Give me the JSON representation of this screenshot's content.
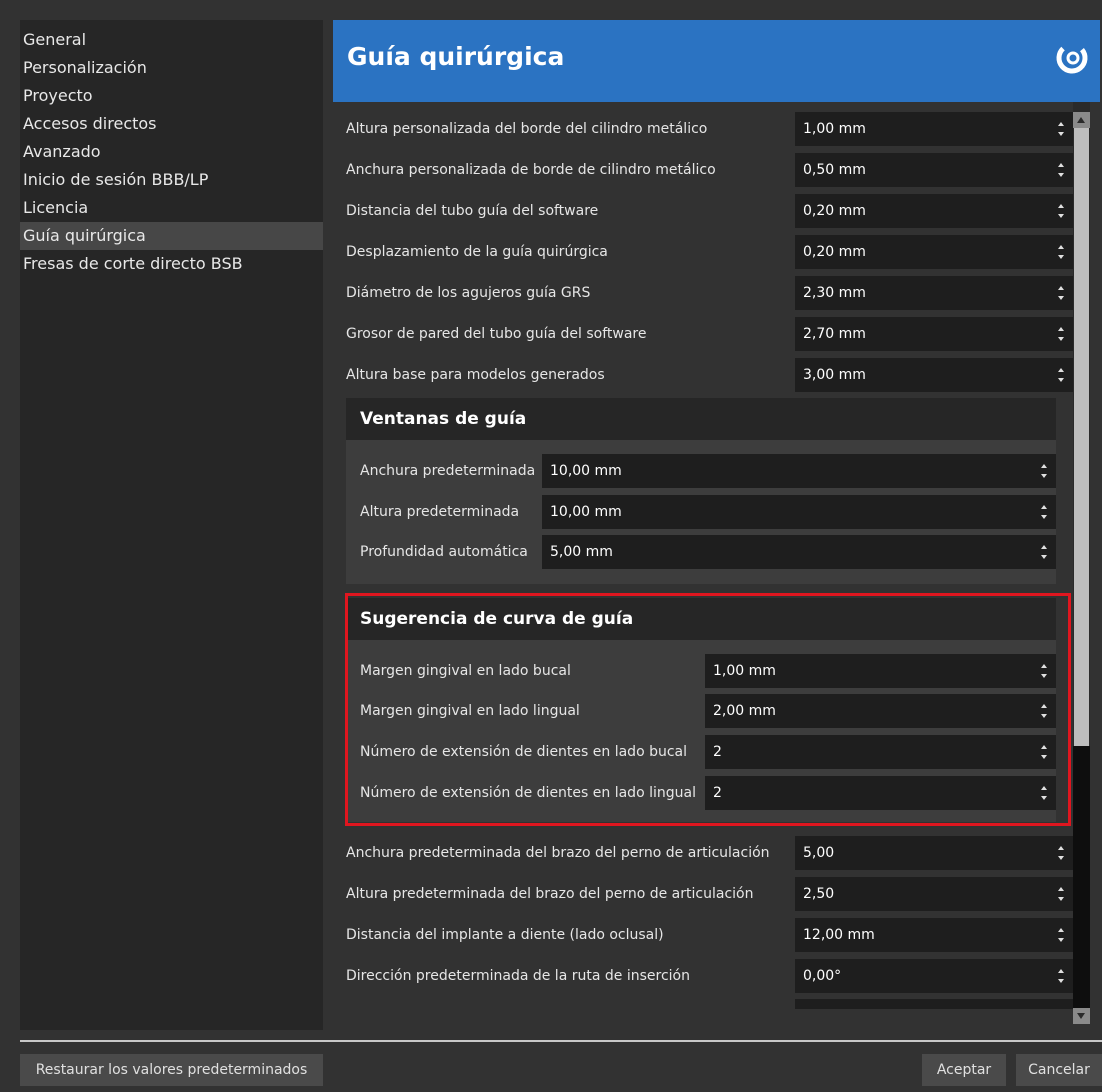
{
  "sidebar": {
    "items": [
      {
        "label": "General"
      },
      {
        "label": "Personalización"
      },
      {
        "label": "Proyecto"
      },
      {
        "label": "Accesos directos"
      },
      {
        "label": "Avanzado"
      },
      {
        "label": "Inicio de sesión BBB/LP"
      },
      {
        "label": "Licencia"
      },
      {
        "label": "Guía quirúrgica",
        "selected": true
      },
      {
        "label": "Fresas de corte directo BSB"
      }
    ]
  },
  "header": {
    "title": "Guía quirúrgica",
    "brand_icon": "swirl-logo-icon",
    "brand_color": "#2b73c2"
  },
  "settings": [
    {
      "label": "Altura personalizada del borde del cilindro metálico",
      "value": "1,00 mm"
    },
    {
      "label": "Anchura personalizada de borde de cilindro metálico",
      "value": "0,50 mm"
    },
    {
      "label": "Distancia del tubo guía del software",
      "value": "0,20 mm"
    },
    {
      "label": "Desplazamiento de la guía quirúrgica",
      "value": "0,20 mm"
    },
    {
      "label": "Diámetro de los agujeros guía GRS",
      "value": "2,30 mm"
    },
    {
      "label": "Grosor de pared del tubo guía del software",
      "value": "2,70 mm"
    },
    {
      "label": "Altura base para modelos generados",
      "value": "3,00 mm"
    }
  ],
  "guide_windows": {
    "title": "Ventanas de guía",
    "fields": [
      {
        "label": "Anchura predeterminada",
        "value": "10,00 mm"
      },
      {
        "label": "Altura predeterminada",
        "value": "10,00 mm"
      },
      {
        "label": "Profundidad automática",
        "value": "5,00 mm"
      }
    ]
  },
  "curve_suggestion": {
    "title": "Sugerencia de curva de guía",
    "highlight_color": "#e0161f",
    "fields": [
      {
        "label": "Margen gingival en lado bucal",
        "value": "1,00 mm"
      },
      {
        "label": "Margen gingival en lado lingual",
        "value": "2,00 mm"
      },
      {
        "label": "Número de extensión de dientes en lado bucal",
        "value": "2"
      },
      {
        "label": "Número de extensión de dientes en lado lingual",
        "value": "2"
      }
    ]
  },
  "more_settings": [
    {
      "label": "Anchura predeterminada del brazo del perno de articulación",
      "value": "5,00"
    },
    {
      "label": "Altura predeterminada del brazo del perno de articulación",
      "value": "2,50"
    },
    {
      "label": "Distancia del implante a diente (lado oclusal)",
      "value": "12,00 mm"
    },
    {
      "label": "Dirección predeterminada de la ruta de inserción",
      "value": "0,00°"
    }
  ],
  "footer": {
    "restore_label": "Restaurar los valores predeterminados",
    "accept_label": "Aceptar",
    "cancel_label": "Cancelar"
  }
}
